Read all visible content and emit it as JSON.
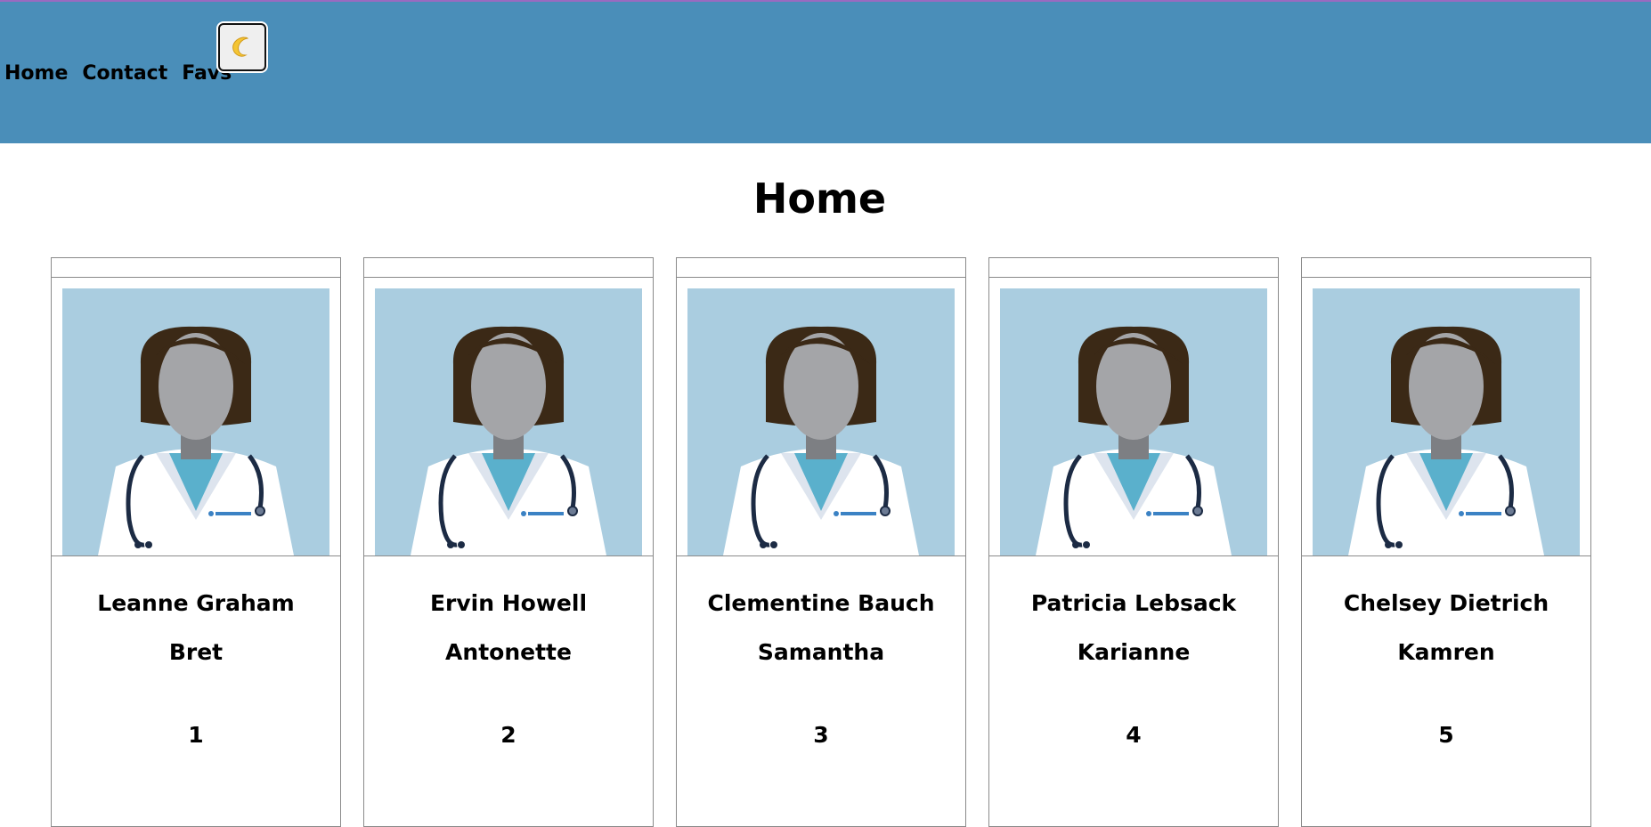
{
  "nav": {
    "items": [
      {
        "label": "Home"
      },
      {
        "label": "Contact"
      },
      {
        "label": "Favs"
      }
    ],
    "theme_toggle_icon": "moon-icon"
  },
  "page": {
    "title": "Home"
  },
  "colors": {
    "header_bg": "#4a8eb9",
    "card_image_bg": "#aacde0",
    "hair": "#3b2916",
    "face": "#a4a5a8",
    "scrubs": "#5ab0cc"
  },
  "cards": [
    {
      "name": "Leanne Graham",
      "username": "Bret",
      "id": "1"
    },
    {
      "name": "Ervin Howell",
      "username": "Antonette",
      "id": "2"
    },
    {
      "name": "Clementine Bauch",
      "username": "Samantha",
      "id": "3"
    },
    {
      "name": "Patricia Lebsack",
      "username": "Karianne",
      "id": "4"
    },
    {
      "name": "Chelsey Dietrich",
      "username": "Kamren",
      "id": "5"
    }
  ]
}
